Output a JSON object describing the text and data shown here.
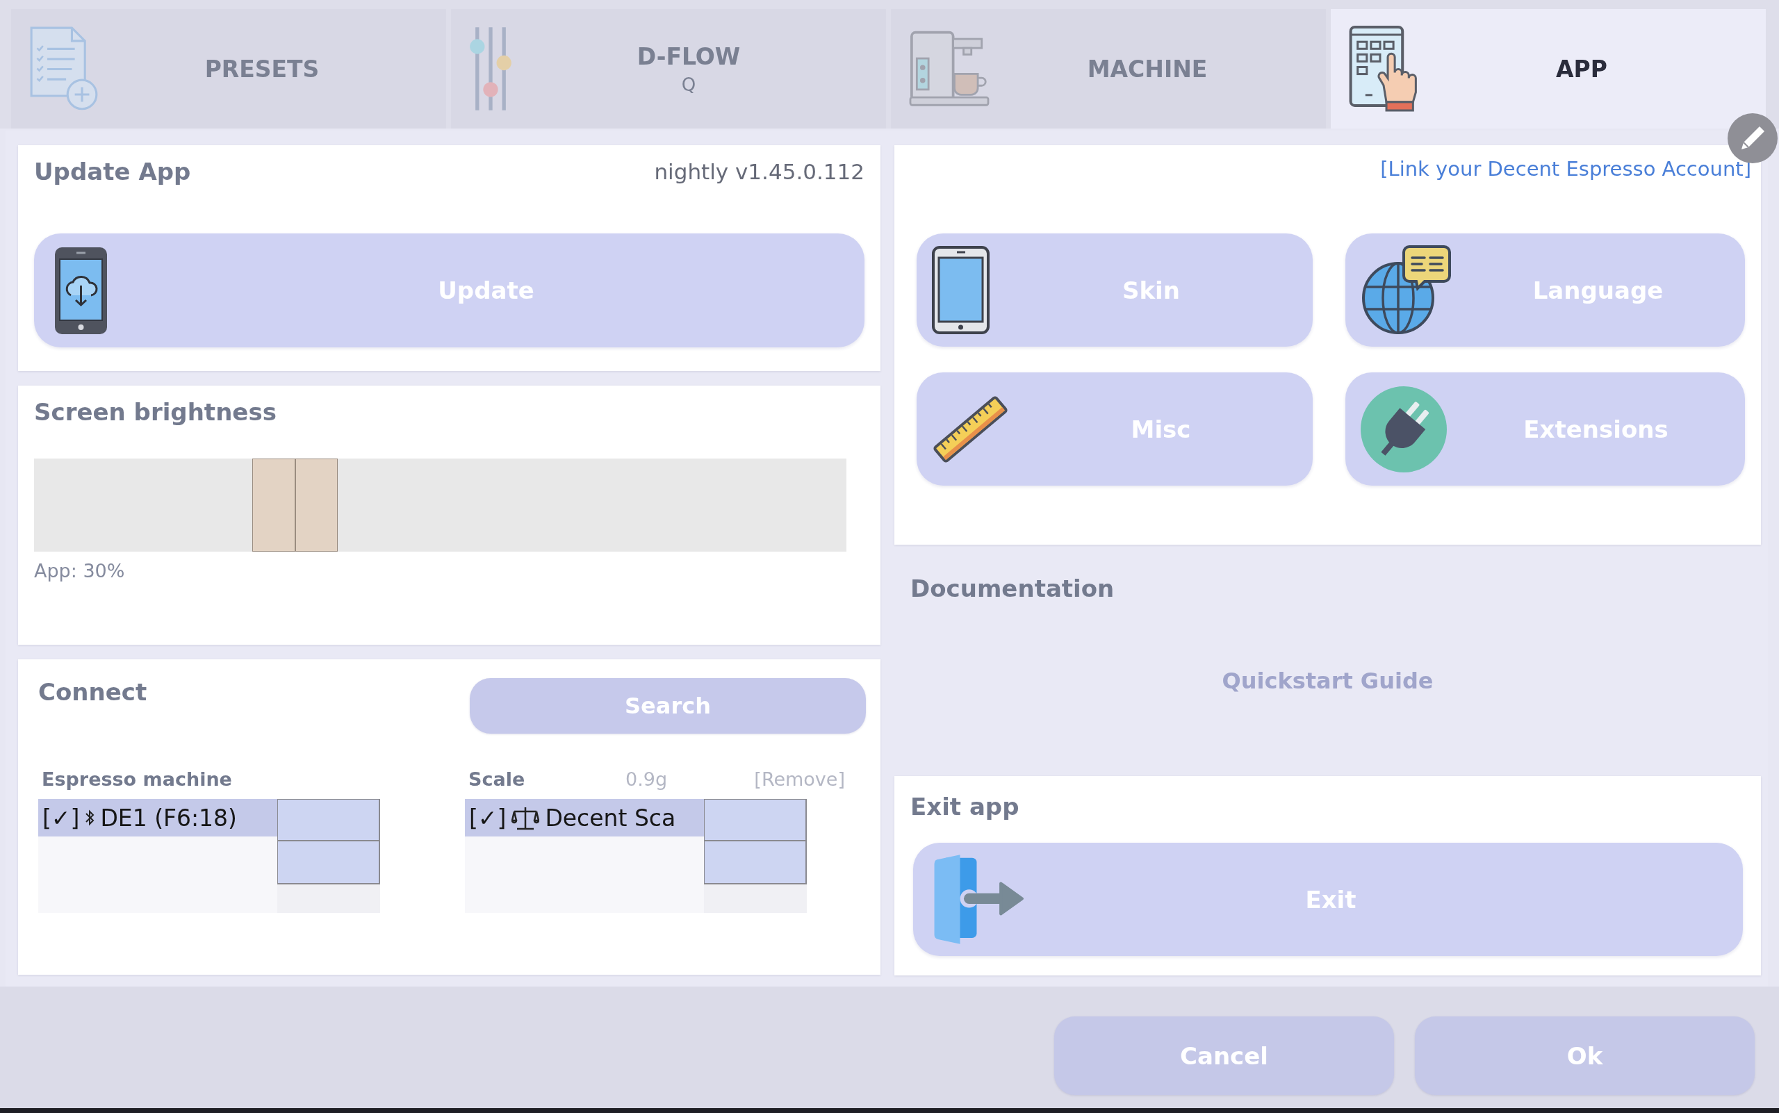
{
  "tabs": [
    {
      "label": "PRESETS",
      "selected": false
    },
    {
      "label": "D-FLOW",
      "sublabel": "Q",
      "selected": false
    },
    {
      "label": "MACHINE",
      "selected": false
    },
    {
      "label": "APP",
      "selected": true
    }
  ],
  "update_app": {
    "title": "Update App",
    "version": "nightly v1.45.0.112",
    "button": "Update"
  },
  "brightness": {
    "title": "Screen brightness",
    "level": 0.3,
    "reading": "App: 30%"
  },
  "connect": {
    "title": "Connect",
    "search_button": "Search",
    "espresso_machine": {
      "label": "Espresso machine",
      "devices": [
        {
          "status": "[✓]",
          "name": "DE1 (F6:18)",
          "selected": true
        }
      ]
    },
    "scale": {
      "label": "Scale",
      "weight": "0.9g",
      "remove_link": "[Remove]",
      "devices": [
        {
          "status": "[✓]",
          "name": "Decent Sca",
          "selected": true
        }
      ]
    }
  },
  "app_settings": {
    "account_link": "[Link your Decent Espresso Account]",
    "buttons": [
      "Skin",
      "Language",
      "Misc",
      "Extensions"
    ]
  },
  "documentation": {
    "title": "Documentation",
    "quickstart_button": "Quickstart Guide"
  },
  "exit_app": {
    "title": "Exit app",
    "button": "Exit"
  },
  "footer": {
    "cancel_button": "Cancel",
    "ok_button": "Ok"
  }
}
